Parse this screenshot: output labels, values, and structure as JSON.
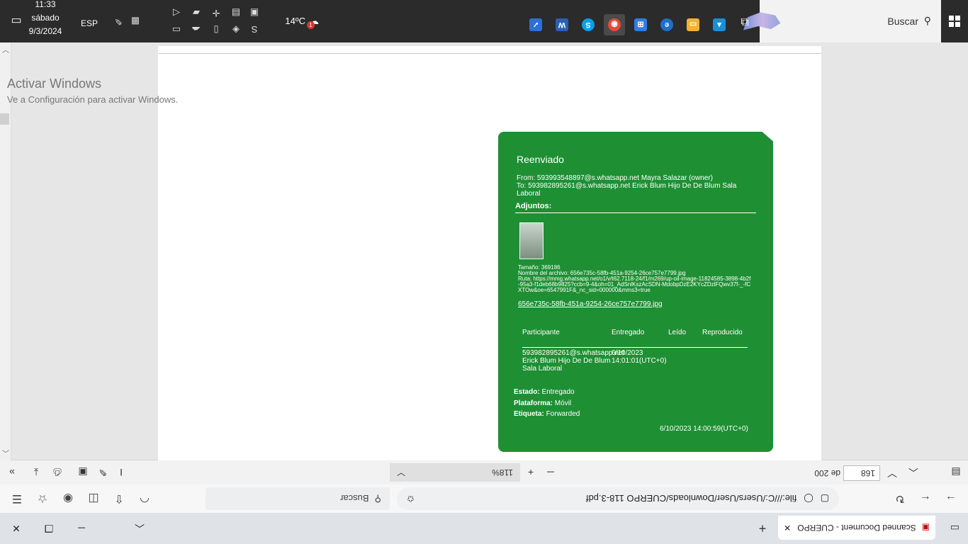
{
  "taskbar": {
    "search_label": "Buscar",
    "weather_temp": "14ºC",
    "weather_badge": "1",
    "language": "ESP",
    "time": "11:33",
    "day": "sábado",
    "date": "9/3/2024",
    "pinned_apps": [
      {
        "name": "photos",
        "color": "#1a8fd6",
        "glyph": "▲"
      },
      {
        "name": "file-explorer",
        "color": "#f2b233",
        "glyph": "▭"
      },
      {
        "name": "edge",
        "color": "#1f6fc9",
        "glyph": "e"
      },
      {
        "name": "microsoft-store",
        "color": "#2f7de1",
        "glyph": "⊞"
      },
      {
        "name": "chrome",
        "color": "#e44a3a",
        "glyph": "◉"
      },
      {
        "name": "skype",
        "color": "#0aa0e6",
        "glyph": "S"
      },
      {
        "name": "word",
        "color": "#2b5fb4",
        "glyph": "W"
      },
      {
        "name": "todo",
        "color": "#2f6fd6",
        "glyph": "✓"
      }
    ]
  },
  "browser": {
    "tab_title": "Scanned Document - CUERPO 118-...",
    "url": "file:///C:/Users/User/Downloads/CUERPO 118-3.pdf",
    "pdf_search_placeholder": "Buscar"
  },
  "pdf_toolbar": {
    "page_current": "168",
    "page_total": "de 200",
    "zoom": "118%"
  },
  "watermark": {
    "title": "Activar Windows",
    "subtitle": "Ve a Configuración para activar Windows."
  },
  "card": {
    "title": "Reenviado",
    "from": "From: 593993548897@s.whatsapp.net Mayra Salazar (owner)",
    "to": "To: 593982895261@s.whatsapp.net Erick Blum Hijo De De Blum Sala Laboral",
    "attachments_label": "Adjuntos:",
    "size": "Tamaño: 369186",
    "filename": "Nombre del archivo: 656e735c-58fb-451a-9254-26ce757e7799.jpg",
    "route": "Ruta: https://mmg.whatsapp.net/o1/v/t62.7118-24/f1/m269/up-oil-image-11824585-3898-4b2f-95a3-f1deb68b9825?ccb=9-4&oh=01_AdSnlKszAcSDN-MdobpDzE2KYcZDzlFQwv37f-_-fCXTOw&oe=6547991F&_nc_sid=000000&mms3=true",
    "link": "656e735c-58fb-451a-9254-26ce757e7799.jpg",
    "table_headers": [
      "Participante",
      "Entregado",
      "Leído",
      "Reproducido"
    ],
    "participant": "593982895261@s.whatsapp.net Erick Blum Hijo De De Blum Sala Laboral",
    "delivered": "6/10/2023 14:01:01(UTC+0)",
    "estado_label": "Estado:",
    "estado_value": "Entregado",
    "plataforma_label": "Plataforma:",
    "plataforma_value": "Móvil",
    "etiqueta_label": "Etiqueta:",
    "etiqueta_value": "Forwarded",
    "timestamp": "6/10/2023 14:00:59(UTC+0)"
  }
}
